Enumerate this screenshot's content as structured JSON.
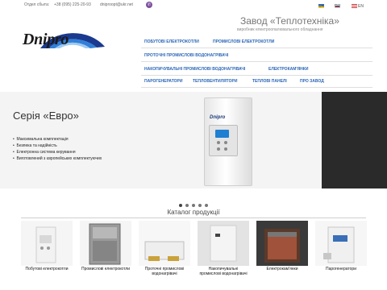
{
  "topbar": {
    "sales_label": "Отдел сбыта:",
    "phone": "+38 (095) 225-20-93",
    "email": "dniproopt@ukr.net",
    "viber_icon": "viber-icon",
    "languages": [
      "UA",
      "RU",
      "EN"
    ]
  },
  "logo": {
    "text": "Dnipro",
    "arc_colors": [
      "#1a3a8f",
      "#2f7fd8",
      "#9ec9f2"
    ]
  },
  "company": {
    "name": "Завод «Теплотехніка»",
    "subtitle": "виробник електроопалювального обладнання"
  },
  "menu": {
    "row1": [
      "ПОБУТОВІ ЕЛЕКТРОКОТЛИ",
      "ПРОМИСЛОВІ ЕЛЕКТРОКОТЛИ"
    ],
    "row2": [
      "ПРОТОЧНІ ПРОМИСЛОВІ ВОДОНАГРІВАЧІ"
    ],
    "row3": [
      "НАКОПИЧУВАЛЬНІ ПРОМИСЛОВІ ВОДОНАГРІВАЧІ",
      "ЕЛЕКТРОКАМ'ЯНКИ"
    ],
    "row4": [
      "ПАРОГЕНЕРАТОРИ",
      "ТЕПЛОВЕНТИЛЯТОРИ",
      "ТЕПЛОВІ ПАНЕЛІ",
      "ПРО ЗАВОД"
    ]
  },
  "banner": {
    "title": "Серія «Евро»",
    "bullets": [
      "Максимальна комплектація",
      "Безпека та надійність",
      "Електронна система керування",
      "Виготовлений з європейських комплектуючих"
    ],
    "product_brand": "Dnipro",
    "slides": 5
  },
  "catalog": {
    "title": "Каталог продукції",
    "items": [
      {
        "label": "Побутові електрокотли"
      },
      {
        "label": "Промислові електрокотли"
      },
      {
        "label": "Проточні промислові водонагрівачі"
      },
      {
        "label": "Накопичувальні промислові водонагрівачі"
      },
      {
        "label": "Електрокам'янки"
      },
      {
        "label": "Парогенератори"
      }
    ]
  },
  "colors": {
    "menu": "#2a66b8",
    "accent_blue": "#1f7fd2",
    "viber": "#7b519d"
  }
}
